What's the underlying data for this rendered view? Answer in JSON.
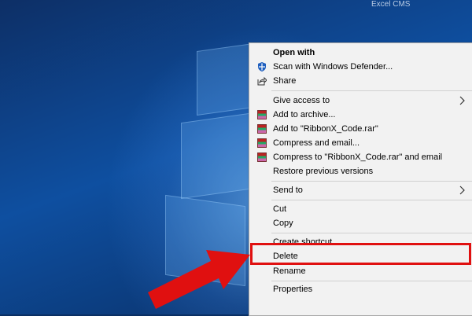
{
  "watermark": "Excel CMS",
  "menu": {
    "items": [
      {
        "label": "Open with",
        "icon": "none",
        "bold": true
      },
      {
        "label": "Scan with Windows Defender...",
        "icon": "defender-icon"
      },
      {
        "label": "Share",
        "icon": "share-icon"
      },
      {
        "label": "Give access to",
        "submenu": true
      },
      {
        "label": "Add to archive...",
        "icon": "winrar-icon"
      },
      {
        "label": "Add to \"RibbonX_Code.rar\"",
        "icon": "winrar-icon"
      },
      {
        "label": "Compress and email...",
        "icon": "winrar-icon"
      },
      {
        "label": "Compress to \"RibbonX_Code.rar\" and email",
        "icon": "winrar-icon"
      },
      {
        "label": "Restore previous versions"
      },
      {
        "label": "Send to",
        "submenu": true
      },
      {
        "label": "Cut"
      },
      {
        "label": "Copy"
      },
      {
        "label": "Create shortcut"
      },
      {
        "label": "Delete"
      },
      {
        "label": "Rename"
      },
      {
        "label": "Properties"
      }
    ]
  },
  "colors": {
    "highlight": "#e01010",
    "arrow": "#e01010",
    "menu_bg": "#f2f2f2"
  }
}
